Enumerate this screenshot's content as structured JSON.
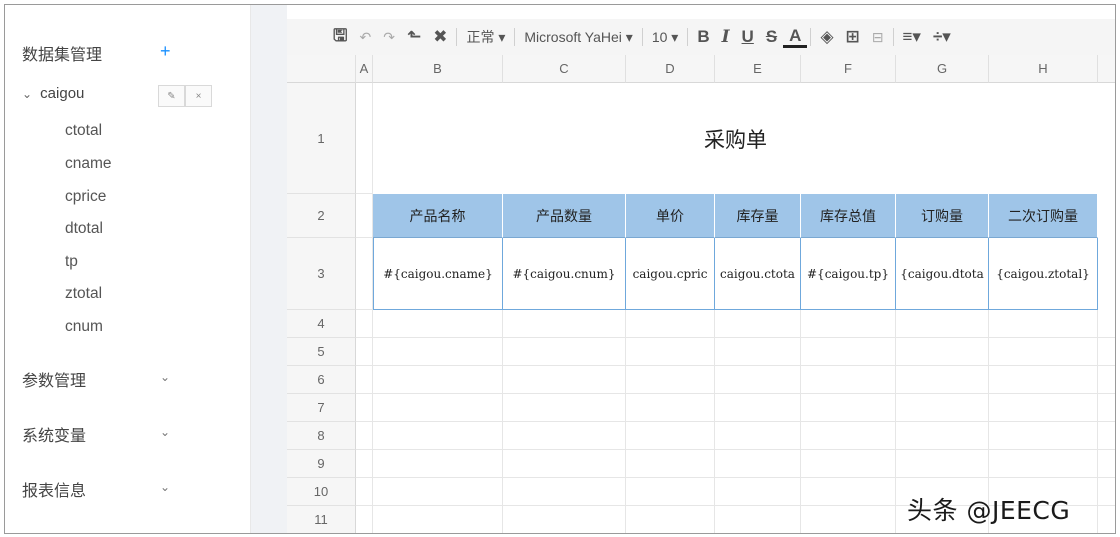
{
  "sidebar": {
    "dataset_title": "数据集管理",
    "add_icon": "+",
    "dataset": {
      "name": "caigou",
      "fields": [
        "ctotal",
        "cname",
        "cprice",
        "dtotal",
        "tp",
        "ztotal",
        "cnum"
      ]
    },
    "sections": [
      {
        "label": "参数管理"
      },
      {
        "label": "系统变量"
      },
      {
        "label": "报表信息"
      }
    ]
  },
  "toolbar": {
    "format": "正常 ▾",
    "font": "Microsoft YaHei ▾",
    "size": "10 ▾"
  },
  "sheet": {
    "columns": [
      "A",
      "B",
      "C",
      "D",
      "E",
      "F",
      "G",
      "H"
    ],
    "rows": [
      "1",
      "2",
      "3",
      "4",
      "5",
      "6",
      "7",
      "8",
      "9",
      "10",
      "11"
    ],
    "title": "采购单",
    "headers": [
      "产品名称",
      "产品数量",
      "单价",
      "库存量",
      "库存总值",
      "订购量",
      "二次订购量"
    ],
    "values": [
      "#{caigou.cname}",
      "#{caigou.cnum}",
      "caigou.cpric",
      "caigou.ctota",
      "#{caigou.tp}",
      "{caigou.dtota",
      "{caigou.ztotal}"
    ]
  },
  "watermark": "头条 @JEECG"
}
